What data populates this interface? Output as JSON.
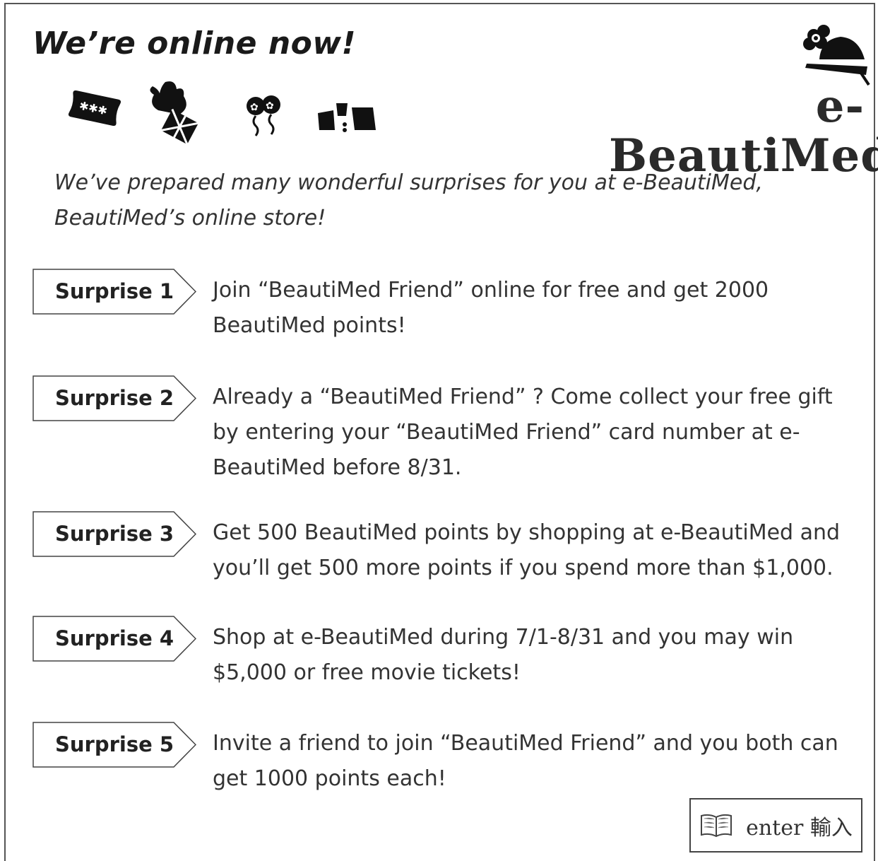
{
  "headline": "We’re online now!",
  "logo": {
    "text": "e-BeautiMed",
    "mascot_icon": "flower-turtle-icon"
  },
  "icons": [
    "ticket-icon",
    "rooster-gift-icon",
    "balloons-icon",
    "shopping-bags-icon"
  ],
  "intro": "We’ve prepared many wonderful surprises for you at e-BeautiMed, BeautiMed’s online store!",
  "surprises": [
    {
      "label": "Surprise 1",
      "text": "Join “BeautiMed Friend” online for free and get 2000 BeautiMed points!"
    },
    {
      "label": "Surprise 2",
      "text": "Already a “BeautiMed Friend” ?  Come collect your free gift by entering your “BeautiMed Friend” card number at e-BeautiMed before 8/31."
    },
    {
      "label": "Surprise 3",
      "text": "Get 500 BeautiMed points by shopping at e-BeautiMed and you’ll get 500 more points if you spend more than $1,000."
    },
    {
      "label": "Surprise 4",
      "text": "Shop at e-BeautiMed during 7/1-8/31 and you may win $5,000 or free movie tickets!"
    },
    {
      "label": "Surprise 5",
      "text": "Invite a friend to join “BeautiMed Friend” and you both can get 1000 points each!"
    }
  ],
  "enter_button": {
    "label": "enter 輸入",
    "icon": "book-icon"
  },
  "colors": {
    "text": "#222222",
    "border": "#444444"
  }
}
